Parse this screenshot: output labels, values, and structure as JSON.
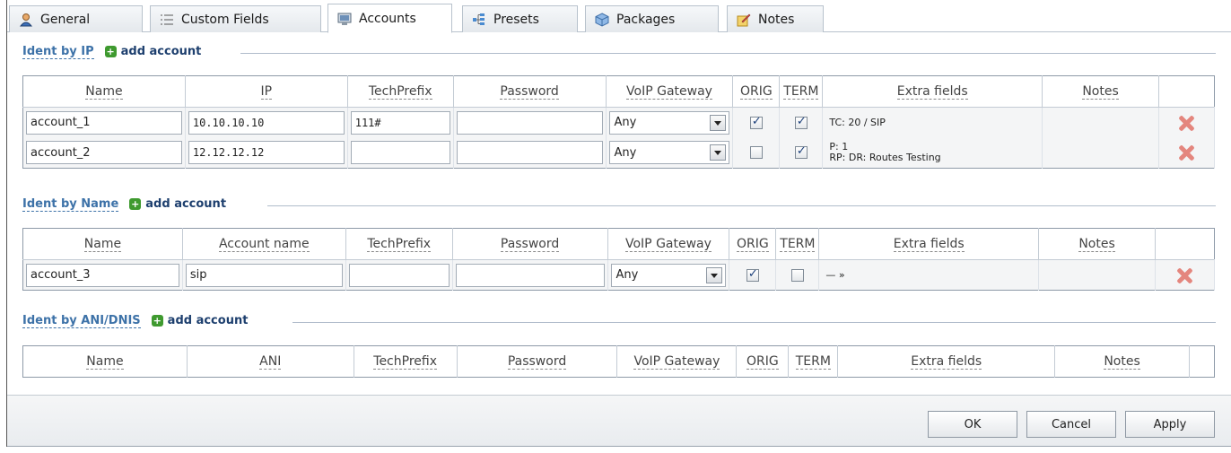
{
  "tabs": [
    {
      "label": "General",
      "icon": "user-icon"
    },
    {
      "label": "Custom Fields",
      "icon": "list-icon"
    },
    {
      "label": "Accounts",
      "icon": "accounts-icon"
    },
    {
      "label": "Presets",
      "icon": "presets-icon"
    },
    {
      "label": "Packages",
      "icon": "package-icon"
    },
    {
      "label": "Notes",
      "icon": "notes-icon"
    }
  ],
  "active_tab": "Accounts",
  "add_label": "add account",
  "sections": {
    "ip": {
      "title": "Ident by IP",
      "headers": [
        "Name",
        "IP",
        "TechPrefix",
        "Password",
        "VoIP Gateway",
        "ORIG",
        "TERM",
        "Extra fields",
        "Notes"
      ],
      "rows": [
        {
          "name": "account_1",
          "ip": "10.10.10.10",
          "techprefix": "111#",
          "password": "",
          "gateway": "Any",
          "orig": true,
          "term": true,
          "extra": [
            "TC: 20 / SIP"
          ],
          "notes": ""
        },
        {
          "name": "account_2",
          "ip": "12.12.12.12",
          "techprefix": "",
          "password": "",
          "gateway": "Any",
          "orig": false,
          "term": true,
          "extra": [
            "P: 1",
            "RP: DR: Routes Testing"
          ],
          "notes": ""
        }
      ]
    },
    "name": {
      "title": "Ident by Name",
      "headers": [
        "Name",
        "Account name",
        "TechPrefix",
        "Password",
        "VoIP Gateway",
        "ORIG",
        "TERM",
        "Extra fields",
        "Notes"
      ],
      "rows": [
        {
          "name": "account_3",
          "account_name": "sip",
          "techprefix": "",
          "password": "",
          "gateway": "Any",
          "orig": true,
          "term": false,
          "extra": [
            "— »"
          ],
          "notes": ""
        }
      ]
    },
    "ani": {
      "title": "Ident by ANI/DNIS",
      "headers": [
        "Name",
        "ANI",
        "TechPrefix",
        "Password",
        "VoIP Gateway",
        "ORIG",
        "TERM",
        "Extra fields",
        "Notes"
      ],
      "rows": []
    }
  },
  "buttons": {
    "ok": "OK",
    "cancel": "Cancel",
    "apply": "Apply"
  }
}
